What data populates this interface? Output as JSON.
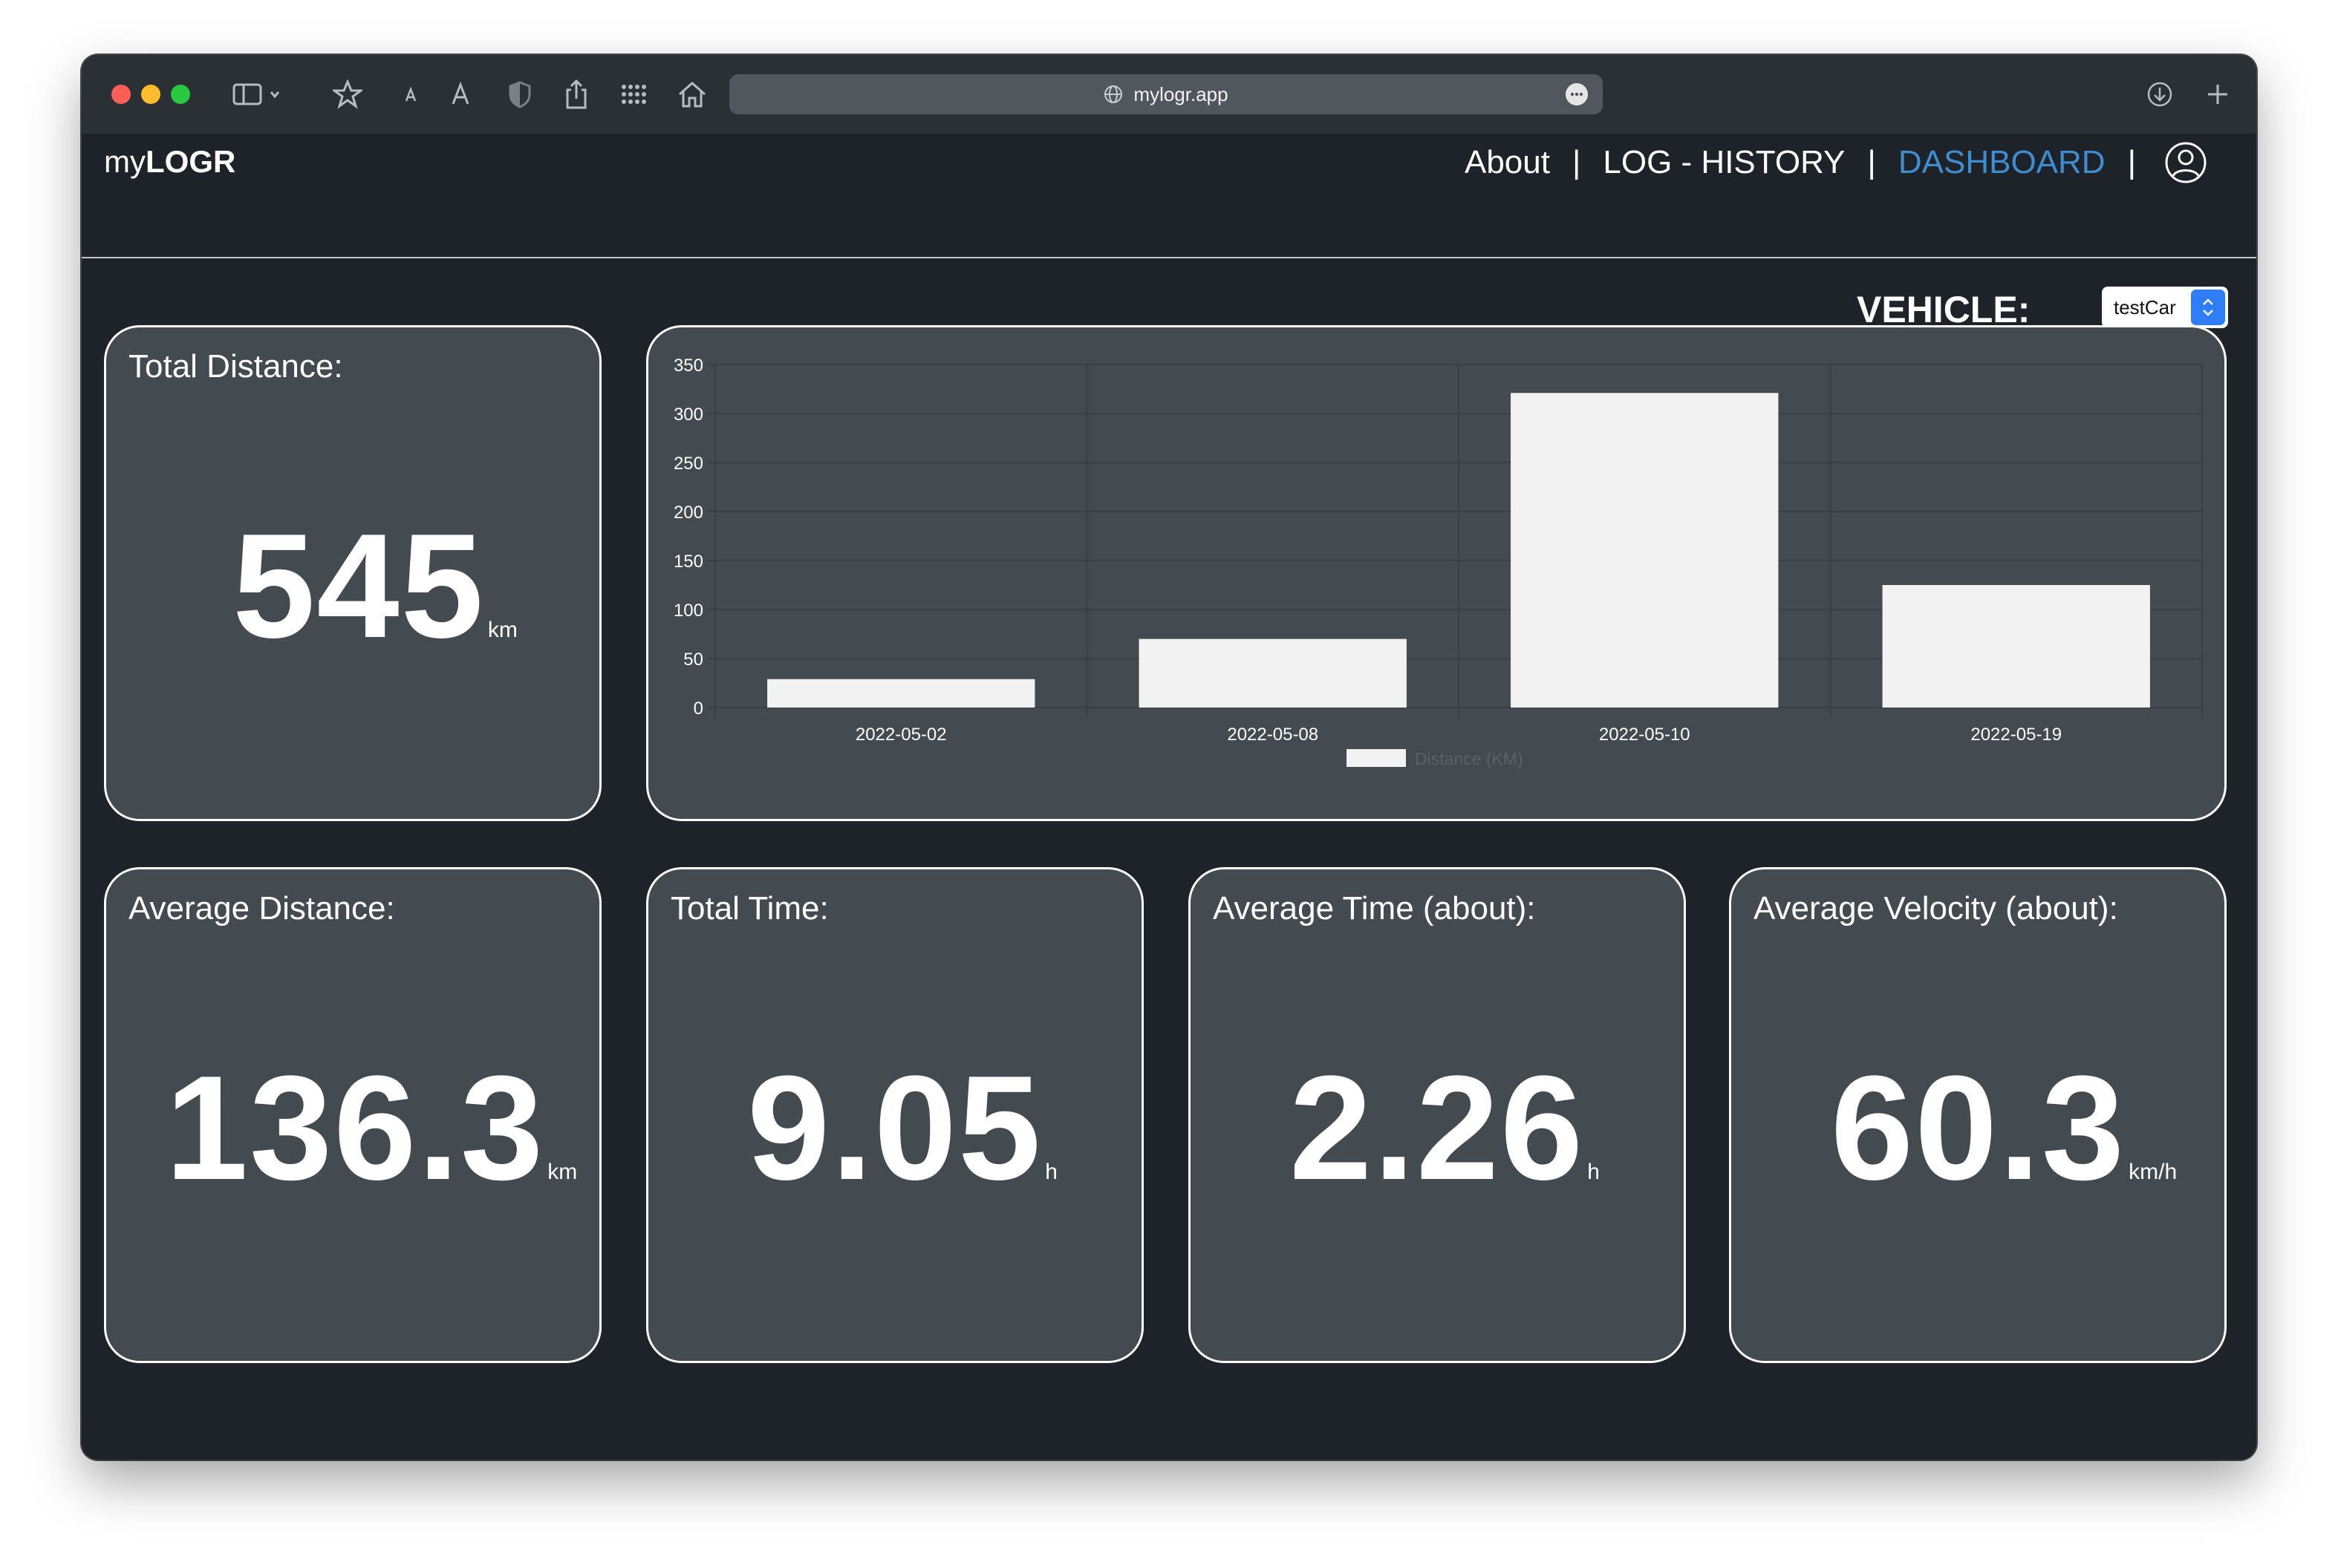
{
  "browser": {
    "url": "mylogr.app"
  },
  "app": {
    "brand_prefix": "my",
    "brand_strong": "LOGR",
    "nav": {
      "about": "About",
      "history": "LOG - HISTORY",
      "dashboard": "DASHBOARD",
      "separator": "|"
    }
  },
  "vehicle": {
    "label": "VEHICLE:",
    "selected": "testCar"
  },
  "cards": {
    "total_distance": {
      "title": "Total Distance:",
      "value": "545",
      "unit": "km"
    },
    "average_distance": {
      "title": "Average Distance:",
      "value": "136.3",
      "unit": "km"
    },
    "total_time": {
      "title": "Total Time:",
      "value": "9.05",
      "unit": "h"
    },
    "average_time": {
      "title": "Average Time (about):",
      "value": "2.26",
      "unit": "h"
    },
    "average_velocity": {
      "title": "Average Velocity (about):",
      "value": "60.3",
      "unit": "km/h"
    }
  },
  "colors": {
    "background": "#1d2329",
    "card": "#434a50",
    "accent": "#3e8ecf",
    "bar": "#f2f2f2"
  },
  "chart_data": {
    "type": "bar",
    "categories": [
      "2022-05-02",
      "2022-05-08",
      "2022-05-10",
      "2022-05-19"
    ],
    "series": [
      {
        "name": "Distance (KM)",
        "values": [
          29,
          70,
          321,
          125
        ]
      }
    ],
    "ylim": [
      0,
      350
    ],
    "yticks": [
      0,
      50,
      100,
      150,
      200,
      250,
      300,
      350
    ],
    "grid": true,
    "legend": "bottom"
  }
}
